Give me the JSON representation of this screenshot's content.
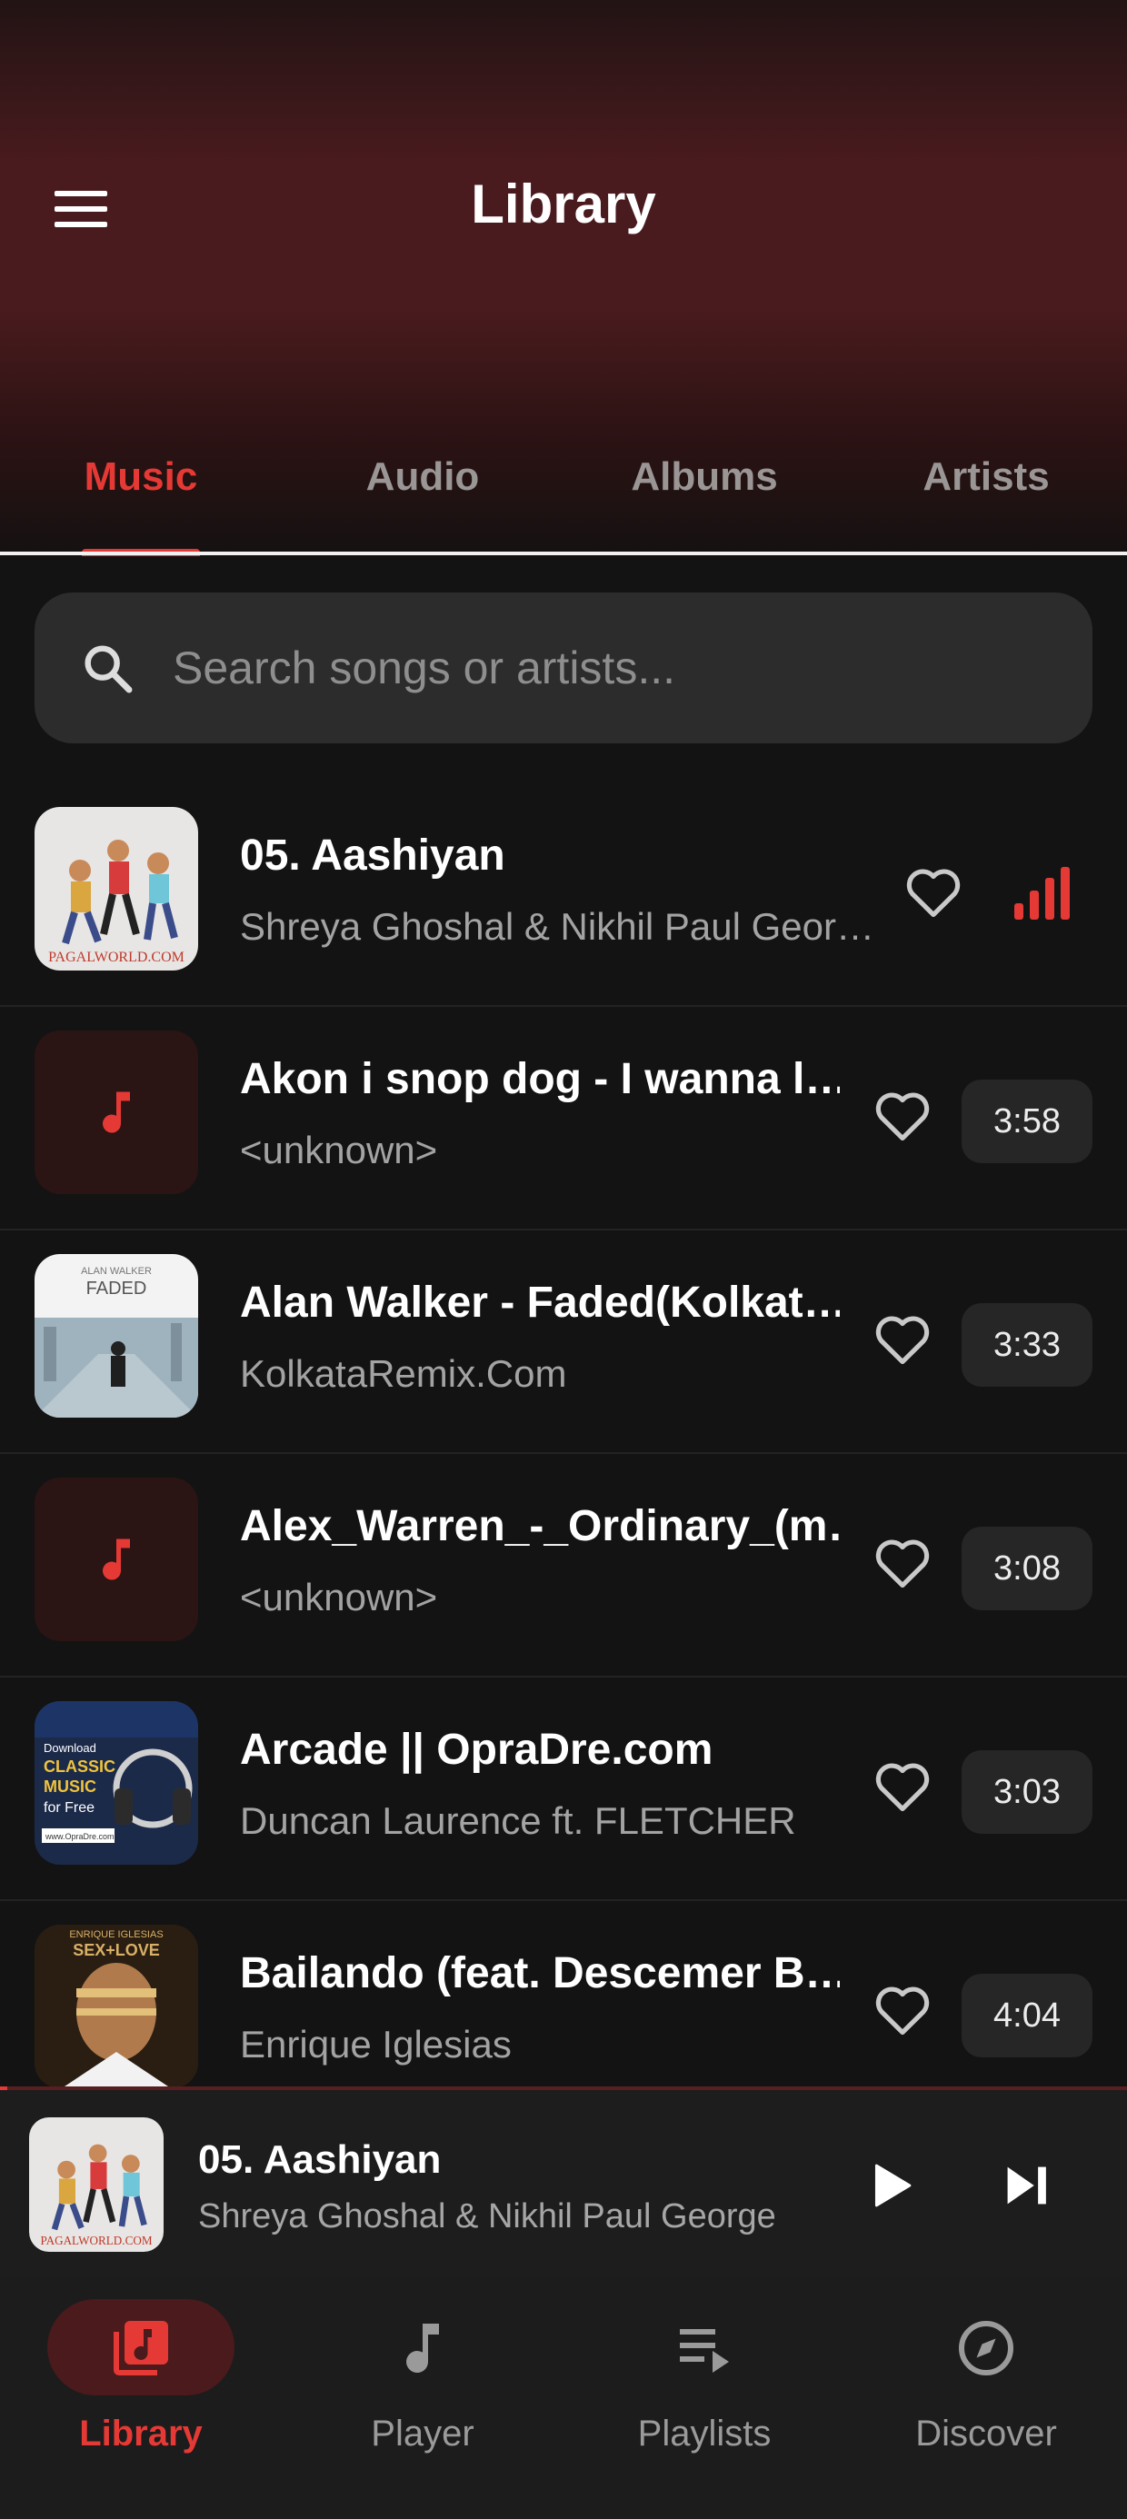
{
  "header": {
    "title": "Library"
  },
  "tabs": [
    {
      "label": "Music",
      "active": true
    },
    {
      "label": "Audio",
      "active": false
    },
    {
      "label": "Albums",
      "active": false
    },
    {
      "label": "Artists",
      "active": false
    }
  ],
  "search": {
    "placeholder": "Search songs or artists..."
  },
  "songs": [
    {
      "title": "05. Aashiyan",
      "artist": "Shreya Ghoshal & Nikhil Paul Geor…",
      "duration": "",
      "playing": true,
      "thumb": "pagalworld-art"
    },
    {
      "title": "Akon i snop dog - I wanna l…",
      "artist": "<unknown>",
      "duration": "3:58",
      "playing": false,
      "thumb": "music-note"
    },
    {
      "title": "Alan Walker - Faded(Kolkat…",
      "artist": "KolkataRemix.Com",
      "duration": "3:33",
      "playing": false,
      "thumb": "faded-art"
    },
    {
      "title": "Alex_Warren_-_Ordinary_(m…",
      "artist": "<unknown>",
      "duration": "3:08",
      "playing": false,
      "thumb": "music-note"
    },
    {
      "title": "Arcade || OpraDre.com",
      "artist": "Duncan Laurence ft. FLETCHER",
      "duration": "3:03",
      "playing": false,
      "thumb": "headphones-art"
    },
    {
      "title": "Bailando (feat. Descemer B…",
      "artist": "Enrique Iglesias",
      "duration": "4:04",
      "playing": false,
      "thumb": "sex-and-love-art"
    }
  ],
  "thumb_text": {
    "pagalworld": "PAGALWORLD.COM",
    "faded_top": "ALAN WALKER",
    "faded": "FADED",
    "classic_1": "Download",
    "classic_2": "CLASSIC",
    "classic_3": "MUSIC",
    "classic_4": "for Free",
    "classic_5": "www.OpraDre.com",
    "enrique_1": "ENRIQUE IGLESIAS",
    "enrique_2": "SEX+LOVE"
  },
  "mini_player": {
    "title": "05. Aashiyan",
    "artist": "Shreya Ghoshal & Nikhil Paul George"
  },
  "bottom_nav": [
    {
      "label": "Library",
      "icon": "library-music-icon",
      "active": true
    },
    {
      "label": "Player",
      "icon": "music-note-icon",
      "active": false
    },
    {
      "label": "Playlists",
      "icon": "playlist-play-icon",
      "active": false
    },
    {
      "label": "Discover",
      "icon": "compass-icon",
      "active": false
    }
  ],
  "colors": {
    "accent": "#e53935",
    "background": "#131313",
    "header": "#4a1b1e"
  }
}
